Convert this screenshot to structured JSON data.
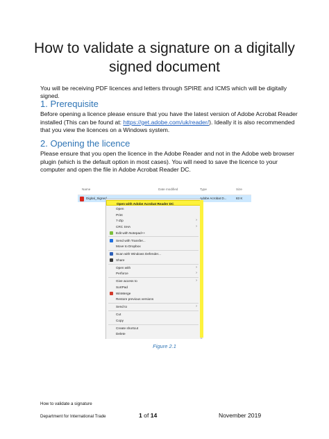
{
  "title_line1": "How to validate a signature on a digitally",
  "title_line2": "signed document",
  "intro": "You will be receiving PDF licences and letters through SPIRE and ICMS which will be digitally signed.",
  "sections": [
    {
      "heading": "1. Prerequisite",
      "lines": [
        "Before opening a licence please ensure that you have the latest version of Adobe Acrobat Reader",
        "installed (This can be found at: ",
        "https://get.adobe.com/uk/reader/",
        ").  Ideally it is also recommended",
        "that you view the licences on a Windows system."
      ]
    },
    {
      "heading": "2. Opening the licence",
      "lines": [
        "Please ensure that you open the licence in the Adobe Reader and not in the Adobe web browser",
        "plugin (which is the default option in most cases). You will need to save the licence to your",
        "computer and open the file in Adobe Acrobat Reader DC."
      ]
    }
  ],
  "figure": {
    "columns": [
      "Name",
      "Date modified",
      "Type",
      "Size"
    ],
    "file": {
      "name": "Digital_Signed_",
      "type": "Adobe Acrobat D...",
      "size": "83 K"
    },
    "menu_items": [
      {
        "label": "Open with Adobe Acrobat Reader DC",
        "submenu": false,
        "highlight": true
      },
      {
        "label": "Open",
        "submenu": false
      },
      {
        "label": "Print",
        "submenu": false
      },
      {
        "label": "7-Zip",
        "submenu": true
      },
      {
        "label": "CRC SHA",
        "submenu": true
      },
      {
        "label": "Edit with Notepad++",
        "submenu": false,
        "icon": "notepad-icon"
      },
      {
        "label": "Send with Transfer...",
        "submenu": false,
        "icon": "dropbox-icon"
      },
      {
        "label": "Move to Dropbox",
        "submenu": false
      },
      {
        "label": "Scan with Windows Defender...",
        "submenu": false,
        "icon": "shield-icon"
      },
      {
        "label": "Share",
        "submenu": false,
        "icon": "share-icon"
      },
      {
        "label": "Open with",
        "submenu": true
      },
      {
        "label": "Perforce",
        "submenu": true
      },
      {
        "label": "Give access to",
        "submenu": true
      },
      {
        "label": "SortPad",
        "submenu": false
      },
      {
        "label": "WinMerge",
        "submenu": false,
        "icon": "winmerge-icon"
      },
      {
        "label": "Restore previous versions",
        "submenu": false
      },
      {
        "label": "Send to",
        "submenu": true
      },
      {
        "label": "Cut",
        "submenu": false
      },
      {
        "label": "Copy",
        "submenu": false
      },
      {
        "label": "Create shortcut",
        "submenu": false
      },
      {
        "label": "Delete",
        "submenu": false
      }
    ],
    "caption": "Figure 2.1"
  },
  "footer": {
    "doc_title": "How to validate a signature",
    "department": "Department for International Trade",
    "page_prefix": "1",
    "page_mid": " of ",
    "page_total": "14",
    "date": "November 2019"
  },
  "colors": {
    "heading": "#2e74b5",
    "highlight": "#fdf23c",
    "link": "#1f5fbf"
  }
}
